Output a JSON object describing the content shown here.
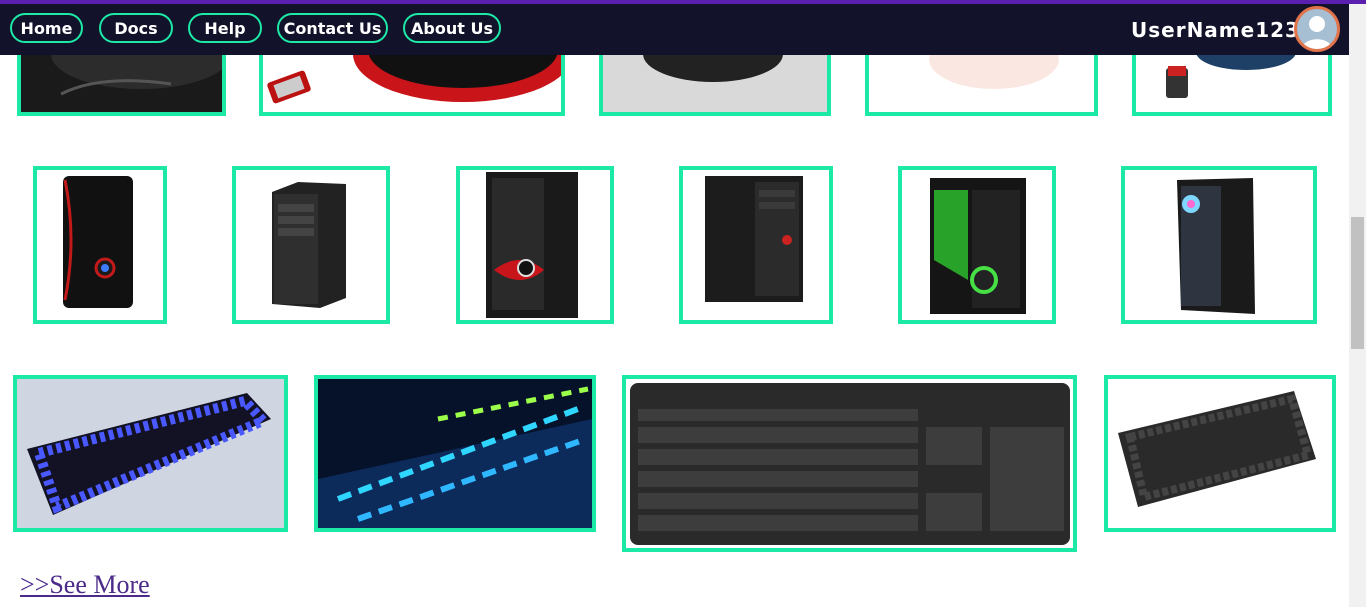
{
  "nav": {
    "items": [
      {
        "label": "Home"
      },
      {
        "label": "Docs"
      },
      {
        "label": "Help"
      },
      {
        "label": "Contact Us"
      },
      {
        "label": "About Us"
      }
    ],
    "username": "UserName123",
    "avatar_icon": "user-avatar-icon"
  },
  "gallery": {
    "rows": [
      {
        "category": "mouse",
        "count": 5
      },
      {
        "category": "cabinet",
        "count": 6
      },
      {
        "category": "keyboard",
        "count": 4
      }
    ]
  },
  "see_more": {
    "label": ">>See More"
  },
  "colors": {
    "navbar_bg": "#13122b",
    "accent": "#1de9a6",
    "top_line": "#5b1fb0",
    "link": "#4b2a8a"
  }
}
